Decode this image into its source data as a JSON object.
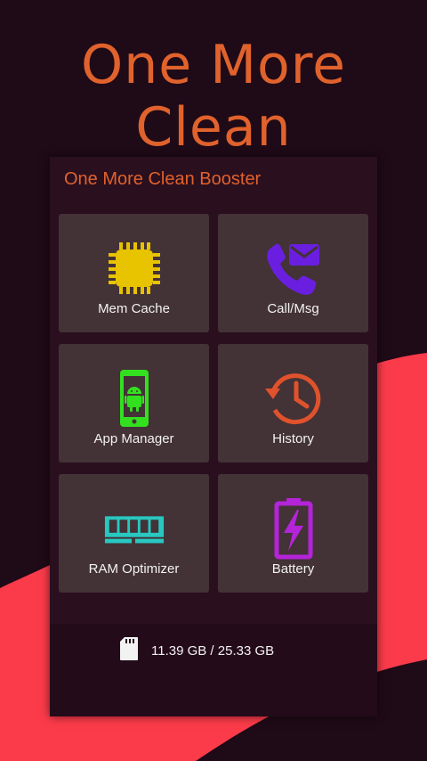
{
  "headline": "One More Clean",
  "colors": {
    "accent": "#e0622c",
    "background": "#1f0a17",
    "swoosh": "#fb3b4a",
    "tile": "#433236",
    "chip": "#e7c300",
    "call": "#6a1fe0",
    "android": "#33e01f",
    "history": "#e0522c",
    "ram": "#28c8c0",
    "battery": "#b424d8"
  },
  "panel": {
    "title": "One More Clean Booster",
    "tiles": [
      {
        "label": "Mem Cache",
        "icon": "chip-icon"
      },
      {
        "label": "Call/Msg",
        "icon": "phone-message-icon"
      },
      {
        "label": "App Manager",
        "icon": "android-phone-icon"
      },
      {
        "label": "History",
        "icon": "history-clock-icon"
      },
      {
        "label": "RAM Optimizer",
        "icon": "ram-stick-icon"
      },
      {
        "label": "Battery",
        "icon": "battery-charging-icon"
      }
    ]
  },
  "storage": {
    "icon": "sd-card-icon",
    "text": "11.39 GB / 25.33 GB"
  }
}
